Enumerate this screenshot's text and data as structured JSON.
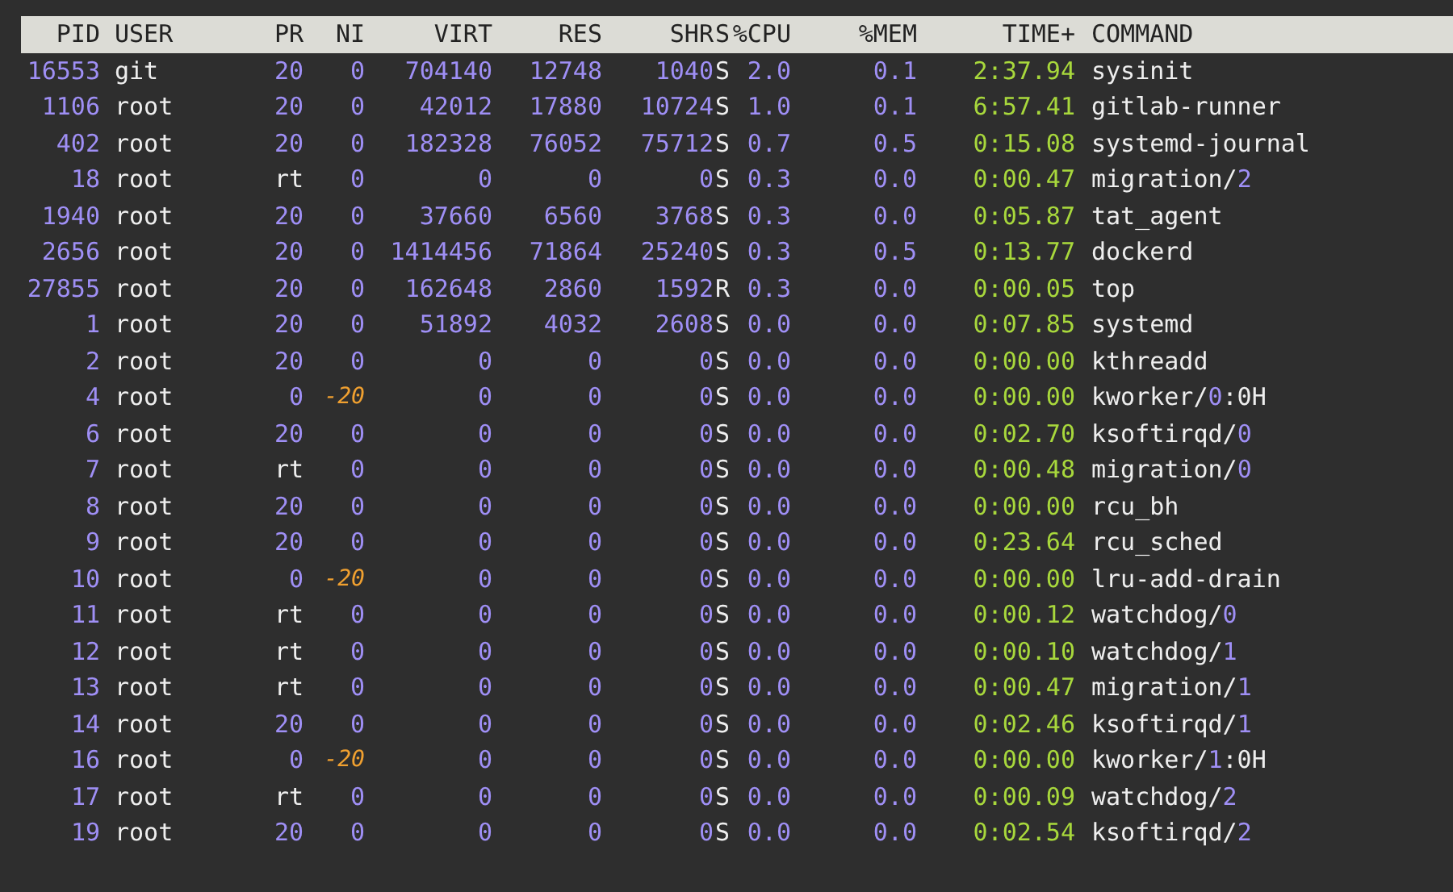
{
  "columns": [
    "PID",
    "USER",
    "PR",
    "NI",
    "VIRT",
    "RES",
    "SHR",
    "S",
    "%CPU",
    "%MEM",
    "TIME+",
    "COMMAND"
  ],
  "processes": [
    {
      "pid": "16553",
      "user": "git",
      "pr": "20",
      "ni": "0",
      "virt": "704140",
      "res": "12748",
      "shr": "1040",
      "s": "S",
      "cpu": "2.0",
      "mem": "0.1",
      "time": "2:37.94",
      "command": "sysinit"
    },
    {
      "pid": "1106",
      "user": "root",
      "pr": "20",
      "ni": "0",
      "virt": "42012",
      "res": "17880",
      "shr": "10724",
      "s": "S",
      "cpu": "1.0",
      "mem": "0.1",
      "time": "6:57.41",
      "command": "gitlab-runner"
    },
    {
      "pid": "402",
      "user": "root",
      "pr": "20",
      "ni": "0",
      "virt": "182328",
      "res": "76052",
      "shr": "75712",
      "s": "S",
      "cpu": "0.7",
      "mem": "0.5",
      "time": "0:15.08",
      "command": "systemd-journal"
    },
    {
      "pid": "18",
      "user": "root",
      "pr": "rt",
      "ni": "0",
      "virt": "0",
      "res": "0",
      "shr": "0",
      "s": "S",
      "cpu": "0.3",
      "mem": "0.0",
      "time": "0:00.47",
      "command": "migration/2"
    },
    {
      "pid": "1940",
      "user": "root",
      "pr": "20",
      "ni": "0",
      "virt": "37660",
      "res": "6560",
      "shr": "3768",
      "s": "S",
      "cpu": "0.3",
      "mem": "0.0",
      "time": "0:05.87",
      "command": "tat_agent"
    },
    {
      "pid": "2656",
      "user": "root",
      "pr": "20",
      "ni": "0",
      "virt": "1414456",
      "res": "71864",
      "shr": "25240",
      "s": "S",
      "cpu": "0.3",
      "mem": "0.5",
      "time": "0:13.77",
      "command": "dockerd"
    },
    {
      "pid": "27855",
      "user": "root",
      "pr": "20",
      "ni": "0",
      "virt": "162648",
      "res": "2860",
      "shr": "1592",
      "s": "R",
      "cpu": "0.3",
      "mem": "0.0",
      "time": "0:00.05",
      "command": "top"
    },
    {
      "pid": "1",
      "user": "root",
      "pr": "20",
      "ni": "0",
      "virt": "51892",
      "res": "4032",
      "shr": "2608",
      "s": "S",
      "cpu": "0.0",
      "mem": "0.0",
      "time": "0:07.85",
      "command": "systemd"
    },
    {
      "pid": "2",
      "user": "root",
      "pr": "20",
      "ni": "0",
      "virt": "0",
      "res": "0",
      "shr": "0",
      "s": "S",
      "cpu": "0.0",
      "mem": "0.0",
      "time": "0:00.00",
      "command": "kthreadd"
    },
    {
      "pid": "4",
      "user": "root",
      "pr": "0",
      "ni": "-20",
      "virt": "0",
      "res": "0",
      "shr": "0",
      "s": "S",
      "cpu": "0.0",
      "mem": "0.0",
      "time": "0:00.00",
      "command": "kworker/0:0H"
    },
    {
      "pid": "6",
      "user": "root",
      "pr": "20",
      "ni": "0",
      "virt": "0",
      "res": "0",
      "shr": "0",
      "s": "S",
      "cpu": "0.0",
      "mem": "0.0",
      "time": "0:02.70",
      "command": "ksoftirqd/0"
    },
    {
      "pid": "7",
      "user": "root",
      "pr": "rt",
      "ni": "0",
      "virt": "0",
      "res": "0",
      "shr": "0",
      "s": "S",
      "cpu": "0.0",
      "mem": "0.0",
      "time": "0:00.48",
      "command": "migration/0"
    },
    {
      "pid": "8",
      "user": "root",
      "pr": "20",
      "ni": "0",
      "virt": "0",
      "res": "0",
      "shr": "0",
      "s": "S",
      "cpu": "0.0",
      "mem": "0.0",
      "time": "0:00.00",
      "command": "rcu_bh"
    },
    {
      "pid": "9",
      "user": "root",
      "pr": "20",
      "ni": "0",
      "virt": "0",
      "res": "0",
      "shr": "0",
      "s": "S",
      "cpu": "0.0",
      "mem": "0.0",
      "time": "0:23.64",
      "command": "rcu_sched"
    },
    {
      "pid": "10",
      "user": "root",
      "pr": "0",
      "ni": "-20",
      "virt": "0",
      "res": "0",
      "shr": "0",
      "s": "S",
      "cpu": "0.0",
      "mem": "0.0",
      "time": "0:00.00",
      "command": "lru-add-drain"
    },
    {
      "pid": "11",
      "user": "root",
      "pr": "rt",
      "ni": "0",
      "virt": "0",
      "res": "0",
      "shr": "0",
      "s": "S",
      "cpu": "0.0",
      "mem": "0.0",
      "time": "0:00.12",
      "command": "watchdog/0"
    },
    {
      "pid": "12",
      "user": "root",
      "pr": "rt",
      "ni": "0",
      "virt": "0",
      "res": "0",
      "shr": "0",
      "s": "S",
      "cpu": "0.0",
      "mem": "0.0",
      "time": "0:00.10",
      "command": "watchdog/1"
    },
    {
      "pid": "13",
      "user": "root",
      "pr": "rt",
      "ni": "0",
      "virt": "0",
      "res": "0",
      "shr": "0",
      "s": "S",
      "cpu": "0.0",
      "mem": "0.0",
      "time": "0:00.47",
      "command": "migration/1"
    },
    {
      "pid": "14",
      "user": "root",
      "pr": "20",
      "ni": "0",
      "virt": "0",
      "res": "0",
      "shr": "0",
      "s": "S",
      "cpu": "0.0",
      "mem": "0.0",
      "time": "0:02.46",
      "command": "ksoftirqd/1"
    },
    {
      "pid": "16",
      "user": "root",
      "pr": "0",
      "ni": "-20",
      "virt": "0",
      "res": "0",
      "shr": "0",
      "s": "S",
      "cpu": "0.0",
      "mem": "0.0",
      "time": "0:00.00",
      "command": "kworker/1:0H"
    },
    {
      "pid": "17",
      "user": "root",
      "pr": "rt",
      "ni": "0",
      "virt": "0",
      "res": "0",
      "shr": "0",
      "s": "S",
      "cpu": "0.0",
      "mem": "0.0",
      "time": "0:00.09",
      "command": "watchdog/2"
    },
    {
      "pid": "19",
      "user": "root",
      "pr": "20",
      "ni": "0",
      "virt": "0",
      "res": "0",
      "shr": "0",
      "s": "S",
      "cpu": "0.0",
      "mem": "0.0",
      "time": "0:02.54",
      "command": "ksoftirqd/2"
    }
  ]
}
